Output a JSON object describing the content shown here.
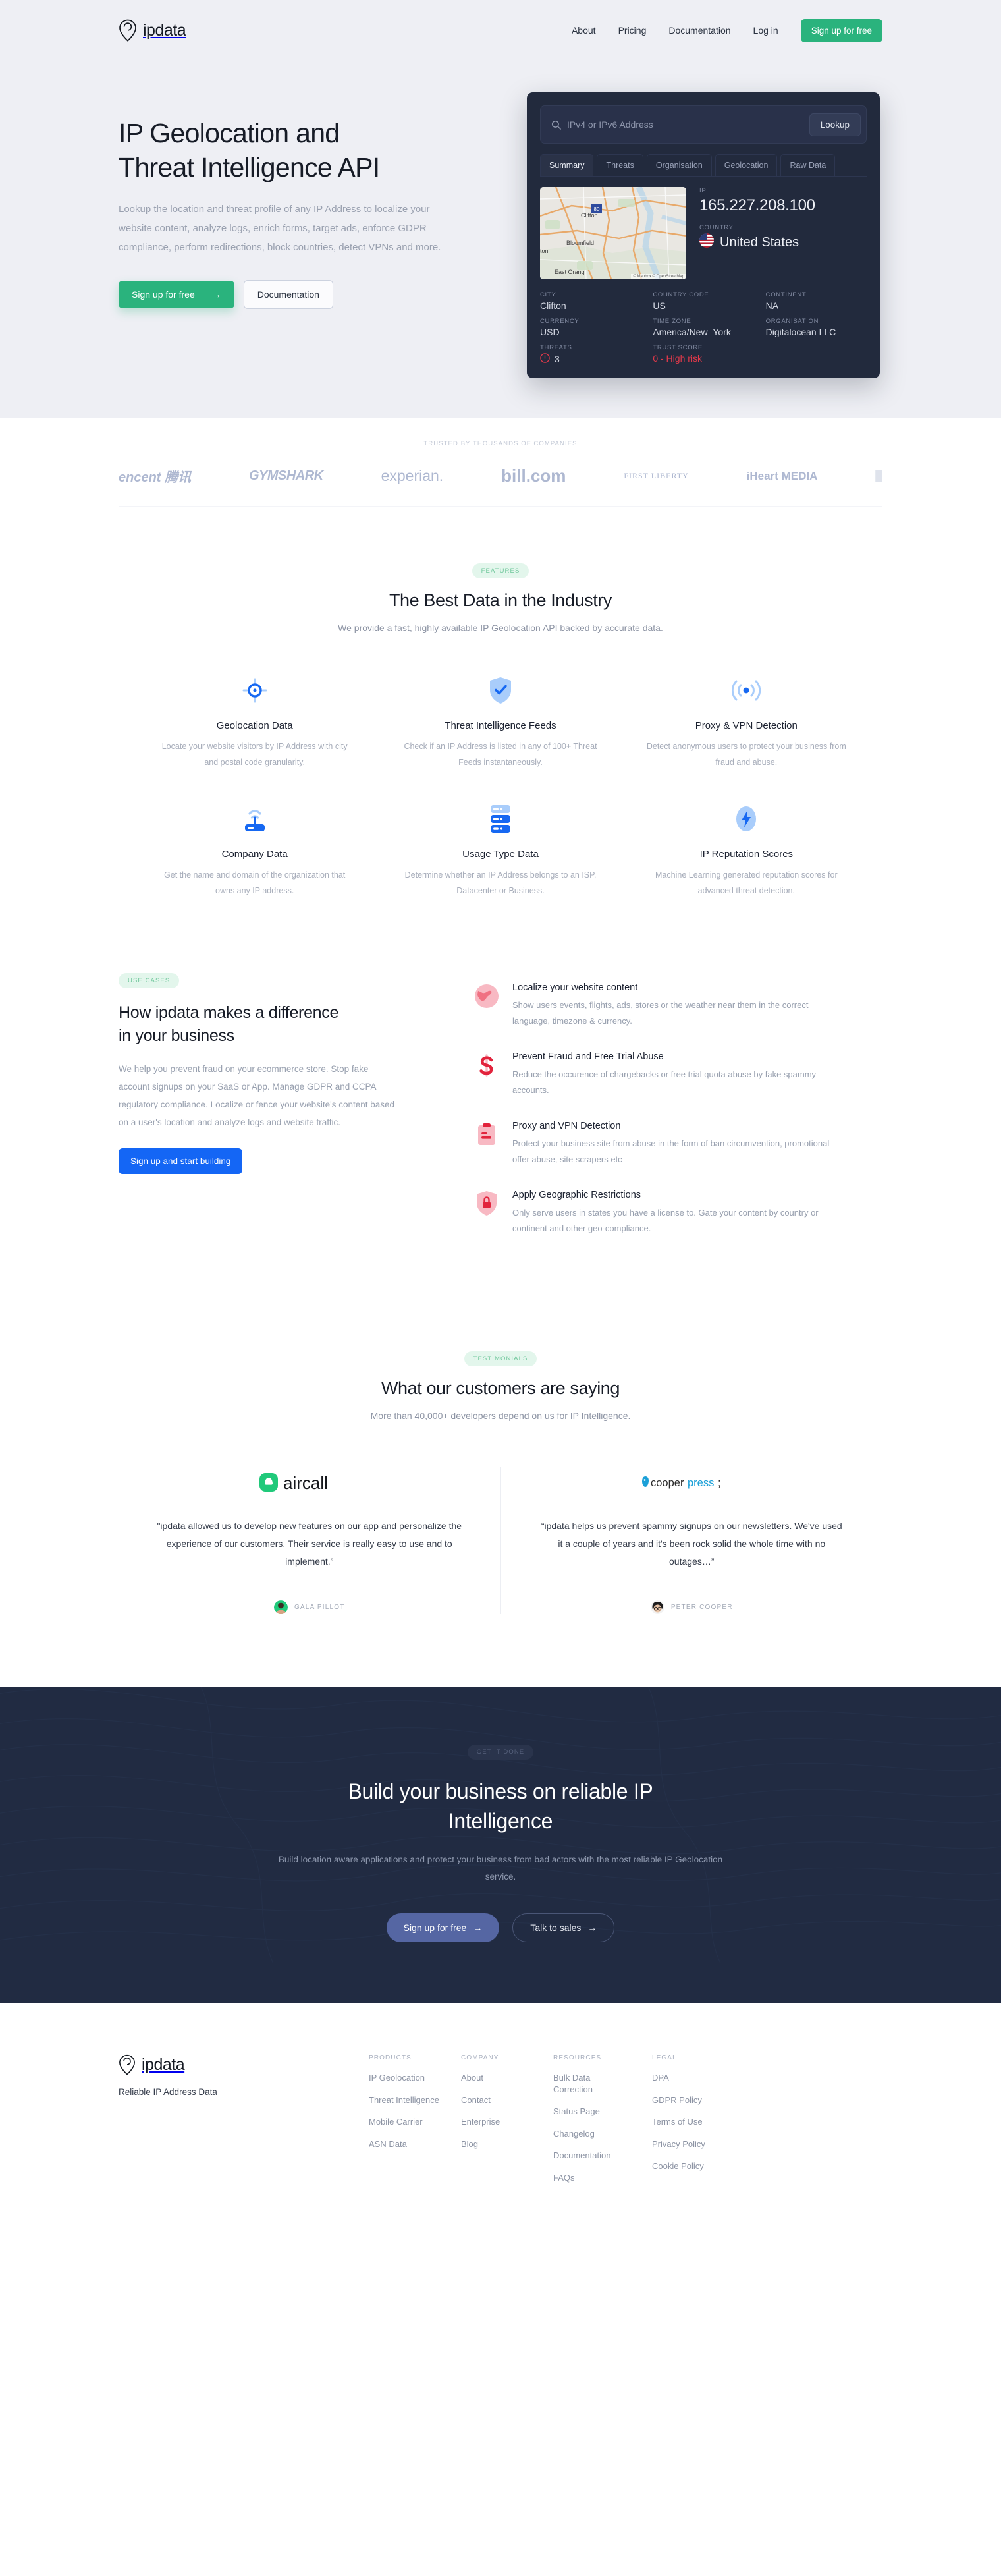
{
  "nav": {
    "logo_text": "ipdata",
    "links": [
      {
        "label": "About"
      },
      {
        "label": "Pricing"
      },
      {
        "label": "Documentation"
      },
      {
        "label": "Log in"
      }
    ],
    "cta_label": "Sign up for free"
  },
  "hero": {
    "title_line1": "IP Geolocation and",
    "title_line2": "Threat Intelligence API",
    "paragraph": "Lookup the location and threat profile of any IP Address to localize your website content, analyze logs, enrich forms, target ads, enforce GDPR compliance, perform redirections, block countries, detect VPNs and more.",
    "primary_cta": "Sign up for free",
    "primary_cta_arrow": "→",
    "secondary_cta": "Documentation"
  },
  "widget": {
    "search_placeholder": "IPv4 or IPv6 Address",
    "search_value": "",
    "lookup_label": "Lookup",
    "tabs": [
      {
        "label": "Summary",
        "active": true
      },
      {
        "label": "Threats",
        "active": false
      },
      {
        "label": "Organisation",
        "active": false
      },
      {
        "label": "Geolocation",
        "active": false
      },
      {
        "label": "Raw Data",
        "active": false
      }
    ],
    "map": {
      "label_1": "Clifton",
      "label_2": "Bloomfield",
      "label_3": "ton",
      "label_4": "East Orang",
      "shield_label": "80",
      "attribution": "© Mapbox © OpenStreetMap"
    },
    "ip_label": "IP",
    "ip_value": "165.227.208.100",
    "country_label": "COUNTRY",
    "country_value": "United States",
    "fields": [
      {
        "label": "CITY",
        "value": "Clifton"
      },
      {
        "label": "COUNTRY CODE",
        "value": "US"
      },
      {
        "label": "CONTINENT",
        "value": "NA"
      },
      {
        "label": "CURRENCY",
        "value": "USD"
      },
      {
        "label": "TIME ZONE",
        "value": "America/New_York"
      },
      {
        "label": "ORGANISATION",
        "value": "Digitalocean LLC"
      }
    ],
    "threats_label": "THREATS",
    "threats_value": "3",
    "trust_label": "TRUST SCORE",
    "trust_value": "0 - High risk",
    "risk_color": "#e0394a"
  },
  "trust": {
    "title": "TRUSTED BY THOUSANDS OF COMPANIES",
    "logos": [
      {
        "name": "tencent",
        "text": "encent 腾讯"
      },
      {
        "name": "gymshark",
        "text": "GYMSHARK"
      },
      {
        "name": "experian",
        "text": "experian."
      },
      {
        "name": "bill-com",
        "text": "bill.com"
      },
      {
        "name": "first-liberty",
        "text": "FIRST LIBERTY"
      },
      {
        "name": "iheart-media",
        "text": "iHeart MEDIA"
      },
      {
        "name": "partial",
        "text": "█"
      }
    ]
  },
  "features": {
    "pill": "FEATURES",
    "heading": "The Best Data in the Industry",
    "subheading": "We provide a fast, highly available IP Geolocation API backed by accurate data.",
    "items": [
      {
        "icon": "target-icon",
        "title": "Geolocation Data",
        "desc": "Locate your website visitors by IP Address with city and postal code granularity."
      },
      {
        "icon": "shield-check-icon",
        "title": "Threat Intelligence Feeds",
        "desc": "Check if an IP Address is listed in any of 100+ Threat Feeds instantaneously."
      },
      {
        "icon": "broadcast-icon",
        "title": "Proxy & VPN Detection",
        "desc": "Detect anonymous users to protect your business from fraud and abuse."
      },
      {
        "icon": "router-icon",
        "title": "Company Data",
        "desc": "Get the name and domain of the organization that owns any IP address."
      },
      {
        "icon": "servers-icon",
        "title": "Usage Type Data",
        "desc": "Determine whether an IP Address belongs to an ISP, Datacenter or Business."
      },
      {
        "icon": "bolt-icon",
        "title": "IP Reputation Scores",
        "desc": "Machine Learning generated reputation scores for advanced threat detection."
      }
    ]
  },
  "usecases": {
    "pill": "USE CASES",
    "heading_line1": "How ipdata makes a difference",
    "heading_line2": "in your business",
    "paragraph": "We help you prevent fraud on your ecommerce store. Stop fake account signups on your SaaS or App. Manage GDPR and CCPA regulatory compliance. Localize or fence your website's content based on a user's location and analyze logs and website traffic.",
    "cta_label": "Sign up and start building",
    "items": [
      {
        "icon": "globe-icon",
        "title": "Localize your website content",
        "desc": "Show users events, flights, ads, stores or the weather near them in the correct language, timezone & currency."
      },
      {
        "icon": "dollar-icon",
        "title": "Prevent Fraud and Free Trial Abuse",
        "desc": "Reduce the occurence of chargebacks or free trial quota abuse by fake spammy accounts."
      },
      {
        "icon": "clipboard-icon",
        "title": "Proxy and VPN Detection",
        "desc": "Protect your business site from abuse in the form of ban circumvention, promotional offer abuse, site scrapers etc"
      },
      {
        "icon": "shield-lock-icon",
        "title": "Apply Geographic Restrictions",
        "desc": "Only serve users in states you have a license to. Gate your content by country or continent and other geo-compliance."
      }
    ]
  },
  "testimonials": {
    "pill": "TESTIMONIALS",
    "heading": "What our customers are saying",
    "subheading": "More than 40,000+ developers depend on us for IP Intelligence.",
    "items": [
      {
        "company": "aircall",
        "quote": "\"ipdata allowed us to develop new features on our app and personalize the experience of our customers. Their service is really easy to use and to implement.”",
        "author": "GALA PILLOT"
      },
      {
        "company": "cooperpress",
        "quote": "“ipdata helps us prevent spammy signups on our newsletters. We've used it a couple of years and it's been rock solid the whole time with no outages…”",
        "author": "PETER COOPER"
      }
    ]
  },
  "cta": {
    "pill": "GET IT DONE",
    "heading": "Build your business on reliable IP Intelligence",
    "paragraph": "Build location aware applications and protect your business from bad actors with the most reliable IP Geolocation service.",
    "primary_label": "Sign up for free",
    "primary_arrow": "→",
    "secondary_label": "Talk to sales",
    "secondary_arrow": "→"
  },
  "footer": {
    "logo_text": "ipdata",
    "tagline": "Reliable IP Address Data",
    "columns": [
      {
        "heading": "PRODUCTS",
        "links": [
          "IP Geolocation",
          "Threat Intelligence",
          "Mobile Carrier",
          "ASN Data"
        ]
      },
      {
        "heading": "COMPANY",
        "links": [
          "About",
          "Contact",
          "Enterprise",
          "Blog"
        ]
      },
      {
        "heading": "RESOURCES",
        "links": [
          "Bulk Data Correction",
          "Status Page",
          "Changelog",
          "Documentation",
          "FAQs"
        ]
      },
      {
        "heading": "LEGAL",
        "links": [
          "DPA",
          "GDPR Policy",
          "Terms of Use",
          "Privacy Policy",
          "Cookie Policy"
        ]
      }
    ]
  },
  "colors": {
    "brand_green": "#2ab37d",
    "brand_blue": "#1466f5",
    "dark_navy": "#222a3d",
    "hero_bg": "#eeeff4",
    "risk_red": "#e0394a"
  }
}
